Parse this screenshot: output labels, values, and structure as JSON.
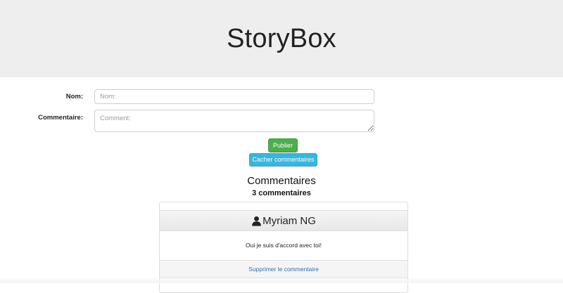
{
  "header": {
    "title": "StoryBox"
  },
  "form": {
    "name_label": "Nom:",
    "name_placeholder": "Nom:",
    "comment_label": "Commentaire:",
    "comment_placeholder": "Comment:",
    "publish_label": "Publier",
    "hide_comments_label": "Cacher commentaires"
  },
  "comments": {
    "heading": "Commentaires",
    "count_text": "3 commentaires",
    "items": [
      {
        "author": "Myriam NG",
        "icon": "user-icon",
        "text": "Oui je suis d'accord avec toi!",
        "delete_label": "Supprimer le commentaire"
      }
    ]
  },
  "colors": {
    "header_bg": "#eeeeee",
    "publish_btn": "#4cae4c",
    "hide_btn": "#3ab5dc",
    "link": "#2a6fb5"
  }
}
